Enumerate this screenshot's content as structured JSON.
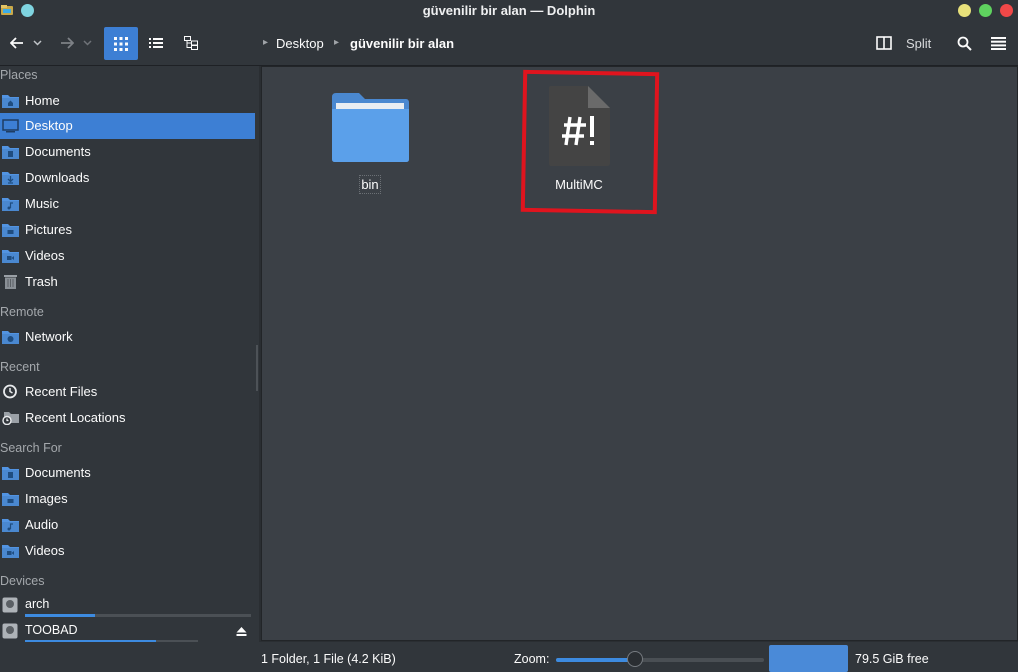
{
  "window": {
    "title": "güvenilir bir alan — Dolphin"
  },
  "breadcrumb": {
    "items": [
      "Desktop",
      "güvenilir bir alan"
    ]
  },
  "toolbar": {
    "split_label": "Split"
  },
  "sidebar": {
    "places_header": "Places",
    "places": [
      "Home",
      "Desktop",
      "Documents",
      "Downloads",
      "Music",
      "Pictures",
      "Videos",
      "Trash"
    ],
    "remote_header": "Remote",
    "remote": [
      "Network"
    ],
    "recent_header": "Recent",
    "recent": [
      "Recent Files",
      "Recent Locations"
    ],
    "search_header": "Search For",
    "search": [
      "Documents",
      "Images",
      "Audio",
      "Videos"
    ],
    "devices_header": "Devices",
    "devices": [
      {
        "name": "arch",
        "usage": 0.31
      },
      {
        "name": "TOOBAD",
        "usage": 0.76
      }
    ]
  },
  "files": [
    {
      "name": "bin",
      "type": "folder"
    },
    {
      "name": "MultiMC",
      "type": "script"
    }
  ],
  "status": {
    "summary": "1 Folder, 1 File (4.2 KiB)",
    "zoom_label": "Zoom:",
    "zoom_value": 0.38,
    "free_space": "79.5 GiB free"
  },
  "colors": {
    "accent": "#3d7fd4",
    "folder": "#5294e2",
    "highlight_box": "#e0141e"
  }
}
